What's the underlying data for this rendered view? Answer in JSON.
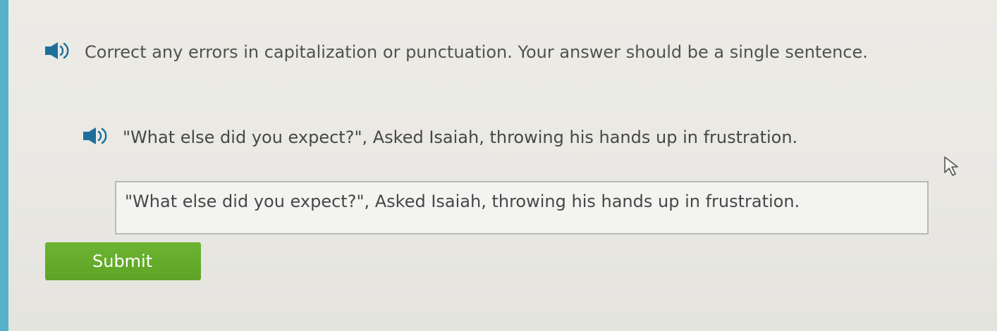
{
  "question": {
    "prompt": "Correct any errors in capitalization or punctuation. Your answer should be a single sentence.",
    "prompt_audio_icon": "speaker-icon",
    "sentence": "\"What else did you expect?\", Asked Isaiah, throwing his hands up in frustration.",
    "sentence_audio_icon": "speaker-icon"
  },
  "answer": {
    "value": "\"What else did you expect?\", Asked Isaiah, throwing his hands up in frustration."
  },
  "actions": {
    "submit_label": "Submit"
  },
  "colors": {
    "accent": "#57b2c9",
    "submit_button": "#63ab2c",
    "speaker_icon": "#1f6f9d"
  }
}
